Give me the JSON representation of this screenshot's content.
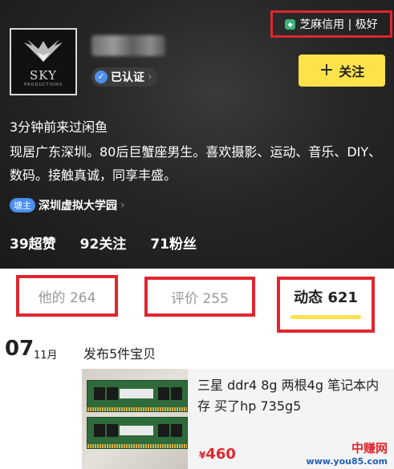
{
  "profile": {
    "avatar_text": "SKY",
    "avatar_subtext": "PRODUCTIONS",
    "verified_label": "已认证",
    "credit_label": "芝麻信用 | 极好",
    "follow_label": "关注",
    "last_seen": "3分钟前来过闲鱼",
    "bio": "现居广东深圳。80后巨蟹座男生。喜欢摄影、运动、音乐、DIY、数码。接触真诚，同享丰盛。",
    "tag_badge": "塘主",
    "tag_name": "深圳虚拟大学园",
    "stats": {
      "likes": "39超赞",
      "following": "92关注",
      "followers": "71粉丝"
    }
  },
  "tabs": {
    "his": "他的 264",
    "reviews": "评价 255",
    "feed": "动态 621"
  },
  "feed": {
    "day": "07",
    "month": "11月",
    "post_title": "发布5件宝贝",
    "item": {
      "description": "三星 ddr4 8g 两根4g 笔记本内存 买了hp 735g5",
      "currency": "¥",
      "price": "460"
    }
  },
  "watermark": {
    "site_name": "中赚网",
    "url": "www.you85.com"
  },
  "colors": {
    "accent_yellow": "#fde24a",
    "highlight_red": "#e0262f",
    "verify_blue": "#4f8ff0"
  }
}
